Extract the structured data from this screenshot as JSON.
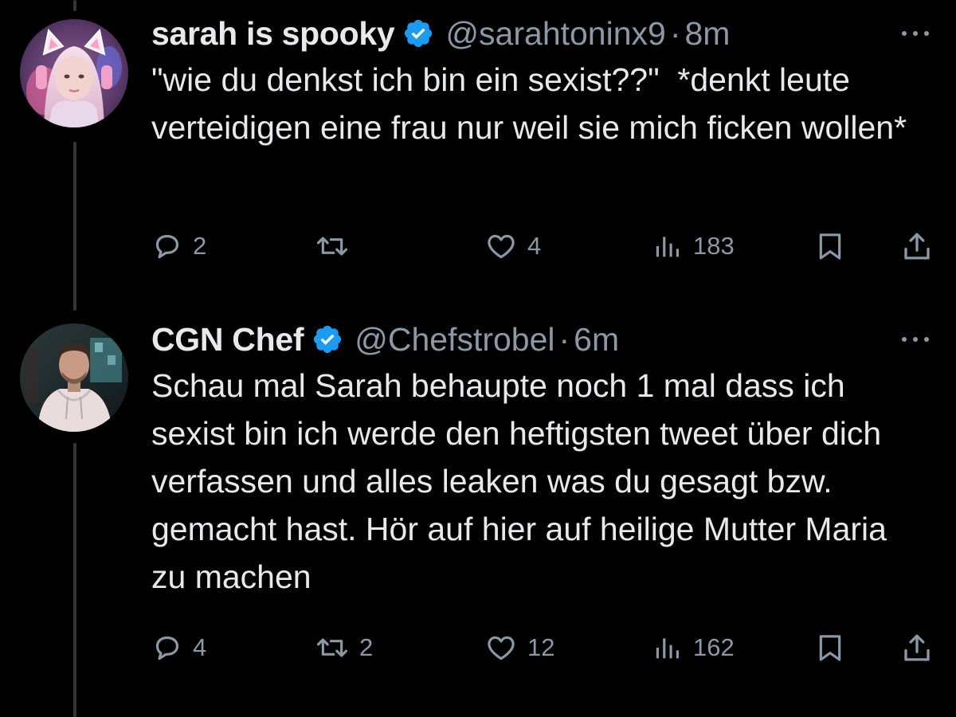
{
  "tweets": [
    {
      "name": "sarah is spooky",
      "handle": "@sarahtoninx9",
      "separator": "·",
      "time": "8m",
      "text": "\"wie du denkst ich bin ein sexist??\"  *denkt leute verteidigen eine frau nur weil sie mich ficken wollen*",
      "verified": true,
      "avatar_icon": "avatar-cat-ear-headset",
      "stats": {
        "replies": "2",
        "reposts": "",
        "likes": "4",
        "views": "183"
      }
    },
    {
      "name": "CGN Chef",
      "handle": "@Chefstrobel",
      "separator": "·",
      "time": "6m",
      "text": "Schau mal Sarah behaupte noch 1 mal dass ich sexist bin ich werde den heftigsten tweet über dich verfassen und alles leaken was du gesagt bzw. gemacht hast. Hör auf hier auf heilige Mutter Maria zu machen",
      "verified": true,
      "avatar_icon": "avatar-man-hoodie",
      "stats": {
        "replies": "4",
        "reposts": "2",
        "likes": "12",
        "views": "162"
      }
    }
  ],
  "icons": {
    "reply": "speech-bubble-icon",
    "repost": "repost-arrows-icon",
    "like": "heart-icon",
    "views": "bar-chart-icon",
    "bookmark": "bookmark-icon",
    "share": "share-upload-icon",
    "more": "more-dots-icon",
    "verified": "verified-badge-icon"
  },
  "colors": {
    "background": "#000000",
    "text": "#e7e9ea",
    "secondary": "#8b98a5",
    "verified": "#1d9bf0",
    "thread_line": "#333639"
  }
}
